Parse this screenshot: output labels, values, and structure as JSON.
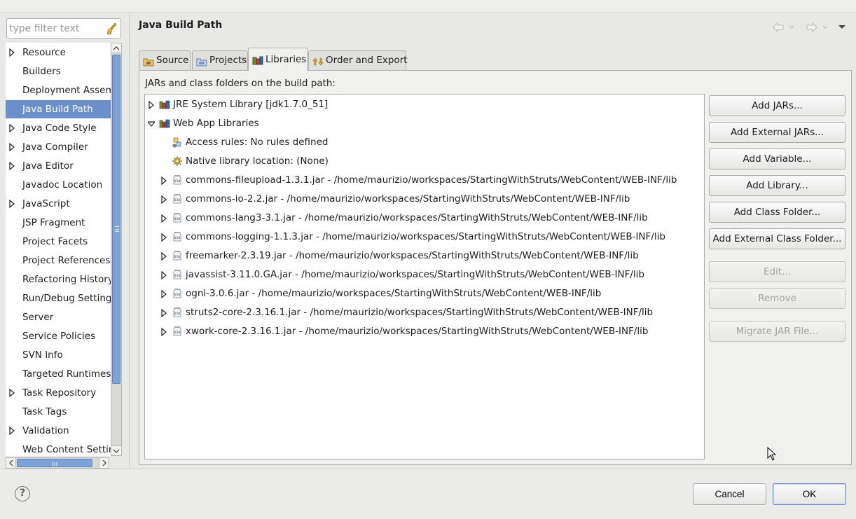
{
  "filter": {
    "placeholder": "type filter text"
  },
  "nav": {
    "items": [
      {
        "label": "Resource",
        "expandable": true
      },
      {
        "label": "Builders",
        "expandable": false
      },
      {
        "label": "Deployment Assembly",
        "expandable": false
      },
      {
        "label": "Java Build Path",
        "expandable": false,
        "selected": true
      },
      {
        "label": "Java Code Style",
        "expandable": true
      },
      {
        "label": "Java Compiler",
        "expandable": true
      },
      {
        "label": "Java Editor",
        "expandable": true
      },
      {
        "label": "Javadoc Location",
        "expandable": false
      },
      {
        "label": "JavaScript",
        "expandable": true
      },
      {
        "label": "JSP Fragment",
        "expandable": false
      },
      {
        "label": "Project Facets",
        "expandable": false
      },
      {
        "label": "Project References",
        "expandable": false
      },
      {
        "label": "Refactoring History",
        "expandable": false
      },
      {
        "label": "Run/Debug Settings",
        "expandable": false
      },
      {
        "label": "Server",
        "expandable": false
      },
      {
        "label": "Service Policies",
        "expandable": false
      },
      {
        "label": "SVN Info",
        "expandable": false
      },
      {
        "label": "Targeted Runtimes",
        "expandable": false
      },
      {
        "label": "Task Repository",
        "expandable": true
      },
      {
        "label": "Task Tags",
        "expandable": false
      },
      {
        "label": "Validation",
        "expandable": true
      },
      {
        "label": "Web Content Settings",
        "expandable": false
      }
    ]
  },
  "header": {
    "title": "Java Build Path"
  },
  "tabs": [
    {
      "label": "Source",
      "icon": "source-folder-icon"
    },
    {
      "label": "Projects",
      "icon": "projects-icon"
    },
    {
      "label": "Libraries",
      "icon": "libraries-icon",
      "active": true
    },
    {
      "label": "Order and Export",
      "icon": "order-export-icon"
    }
  ],
  "libraries": {
    "caption": "JARs and class folders on the build path:",
    "tree": [
      {
        "text": "JRE System Library [jdk1.7.0_51]",
        "level": 0,
        "twisty": "collapsed",
        "icon": "library-icon"
      },
      {
        "text": "Web App Libraries",
        "level": 0,
        "twisty": "expanded",
        "icon": "library-icon"
      },
      {
        "text": "Access rules: No rules defined",
        "level": 1,
        "twisty": "none",
        "icon": "access-rules-icon"
      },
      {
        "text": "Native library location: (None)",
        "level": 1,
        "twisty": "none",
        "icon": "native-library-icon"
      },
      {
        "text": "commons-fileupload-1.3.1.jar - /home/maurizio/workspaces/StartingWithStruts/WebContent/WEB-INF/lib",
        "level": 1,
        "twisty": "collapsed",
        "icon": "jar-icon"
      },
      {
        "text": "commons-io-2.2.jar - /home/maurizio/workspaces/StartingWithStruts/WebContent/WEB-INF/lib",
        "level": 1,
        "twisty": "collapsed",
        "icon": "jar-icon"
      },
      {
        "text": "commons-lang3-3.1.jar - /home/maurizio/workspaces/StartingWithStruts/WebContent/WEB-INF/lib",
        "level": 1,
        "twisty": "collapsed",
        "icon": "jar-icon"
      },
      {
        "text": "commons-logging-1.1.3.jar - /home/maurizio/workspaces/StartingWithStruts/WebContent/WEB-INF/lib",
        "level": 1,
        "twisty": "collapsed",
        "icon": "jar-icon"
      },
      {
        "text": "freemarker-2.3.19.jar - /home/maurizio/workspaces/StartingWithStruts/WebContent/WEB-INF/lib",
        "level": 1,
        "twisty": "collapsed",
        "icon": "jar-icon"
      },
      {
        "text": "javassist-3.11.0.GA.jar - /home/maurizio/workspaces/StartingWithStruts/WebContent/WEB-INF/lib",
        "level": 1,
        "twisty": "collapsed",
        "icon": "jar-icon"
      },
      {
        "text": "ognl-3.0.6.jar - /home/maurizio/workspaces/StartingWithStruts/WebContent/WEB-INF/lib",
        "level": 1,
        "twisty": "collapsed",
        "icon": "jar-icon"
      },
      {
        "text": "struts2-core-2.3.16.1.jar - /home/maurizio/workspaces/StartingWithStruts/WebContent/WEB-INF/lib",
        "level": 1,
        "twisty": "collapsed",
        "icon": "jar-icon"
      },
      {
        "text": "xwork-core-2.3.16.1.jar - /home/maurizio/workspaces/StartingWithStruts/WebContent/WEB-INF/lib",
        "level": 1,
        "twisty": "collapsed",
        "icon": "jar-icon"
      }
    ]
  },
  "buttons": {
    "add_jars": "Add JARs...",
    "add_external_jars": "Add External JARs...",
    "add_variable": "Add Variable...",
    "add_library": "Add Library...",
    "add_class_folder": "Add Class Folder...",
    "add_external_class_folder": "Add External Class Folder...",
    "edit": "Edit...",
    "remove": "Remove",
    "migrate_jar": "Migrate JAR File..."
  },
  "footer": {
    "cancel": "Cancel",
    "ok": "OK"
  }
}
